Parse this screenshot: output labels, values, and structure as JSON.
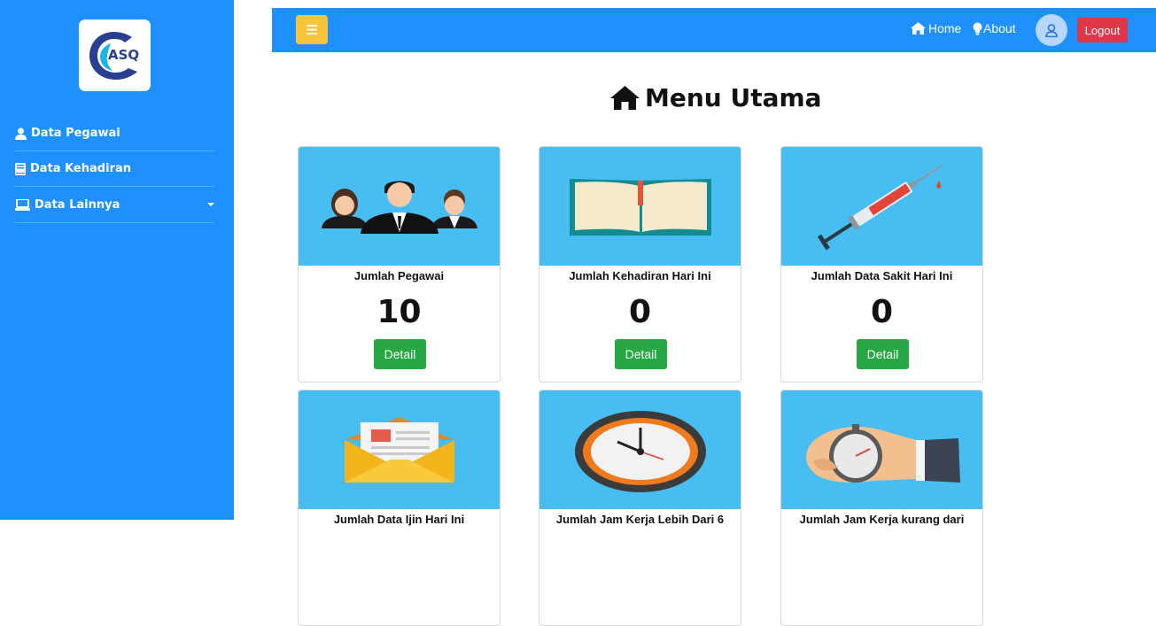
{
  "sidebar": {
    "logo_text": "ASQ",
    "items": [
      {
        "label": "Data Pegawai",
        "icon": "user-icon"
      },
      {
        "label": "Data Kehadiran",
        "icon": "book-icon"
      },
      {
        "label": "Data Lainnya",
        "icon": "laptop-icon"
      }
    ]
  },
  "topbar": {
    "home_label": "Home",
    "about_label": "About",
    "logout_label": "Logout"
  },
  "main": {
    "title": "Menu Utama",
    "cards": [
      {
        "title": "Jumlah Pegawai",
        "value": "10",
        "button": "Detail"
      },
      {
        "title": "Jumlah Kehadiran Hari Ini",
        "value": "0",
        "button": "Detail"
      },
      {
        "title": "Jumlah Data Sakit Hari Ini",
        "value": "0",
        "button": "Detail"
      },
      {
        "title": "Jumlah Data Ijin Hari Ini",
        "value": "",
        "button": ""
      },
      {
        "title": "Jumlah Jam Kerja Lebih Dari 6",
        "value": "",
        "button": ""
      },
      {
        "title": "Jumlah Jam Kerja kurang dari",
        "value": "",
        "button": ""
      }
    ]
  },
  "colors": {
    "sidebar": "#1e90ff",
    "toggle": "#f8c53a",
    "logout": "#e0364a",
    "detail": "#28a745",
    "card_image_bg": "#47bdf1"
  }
}
